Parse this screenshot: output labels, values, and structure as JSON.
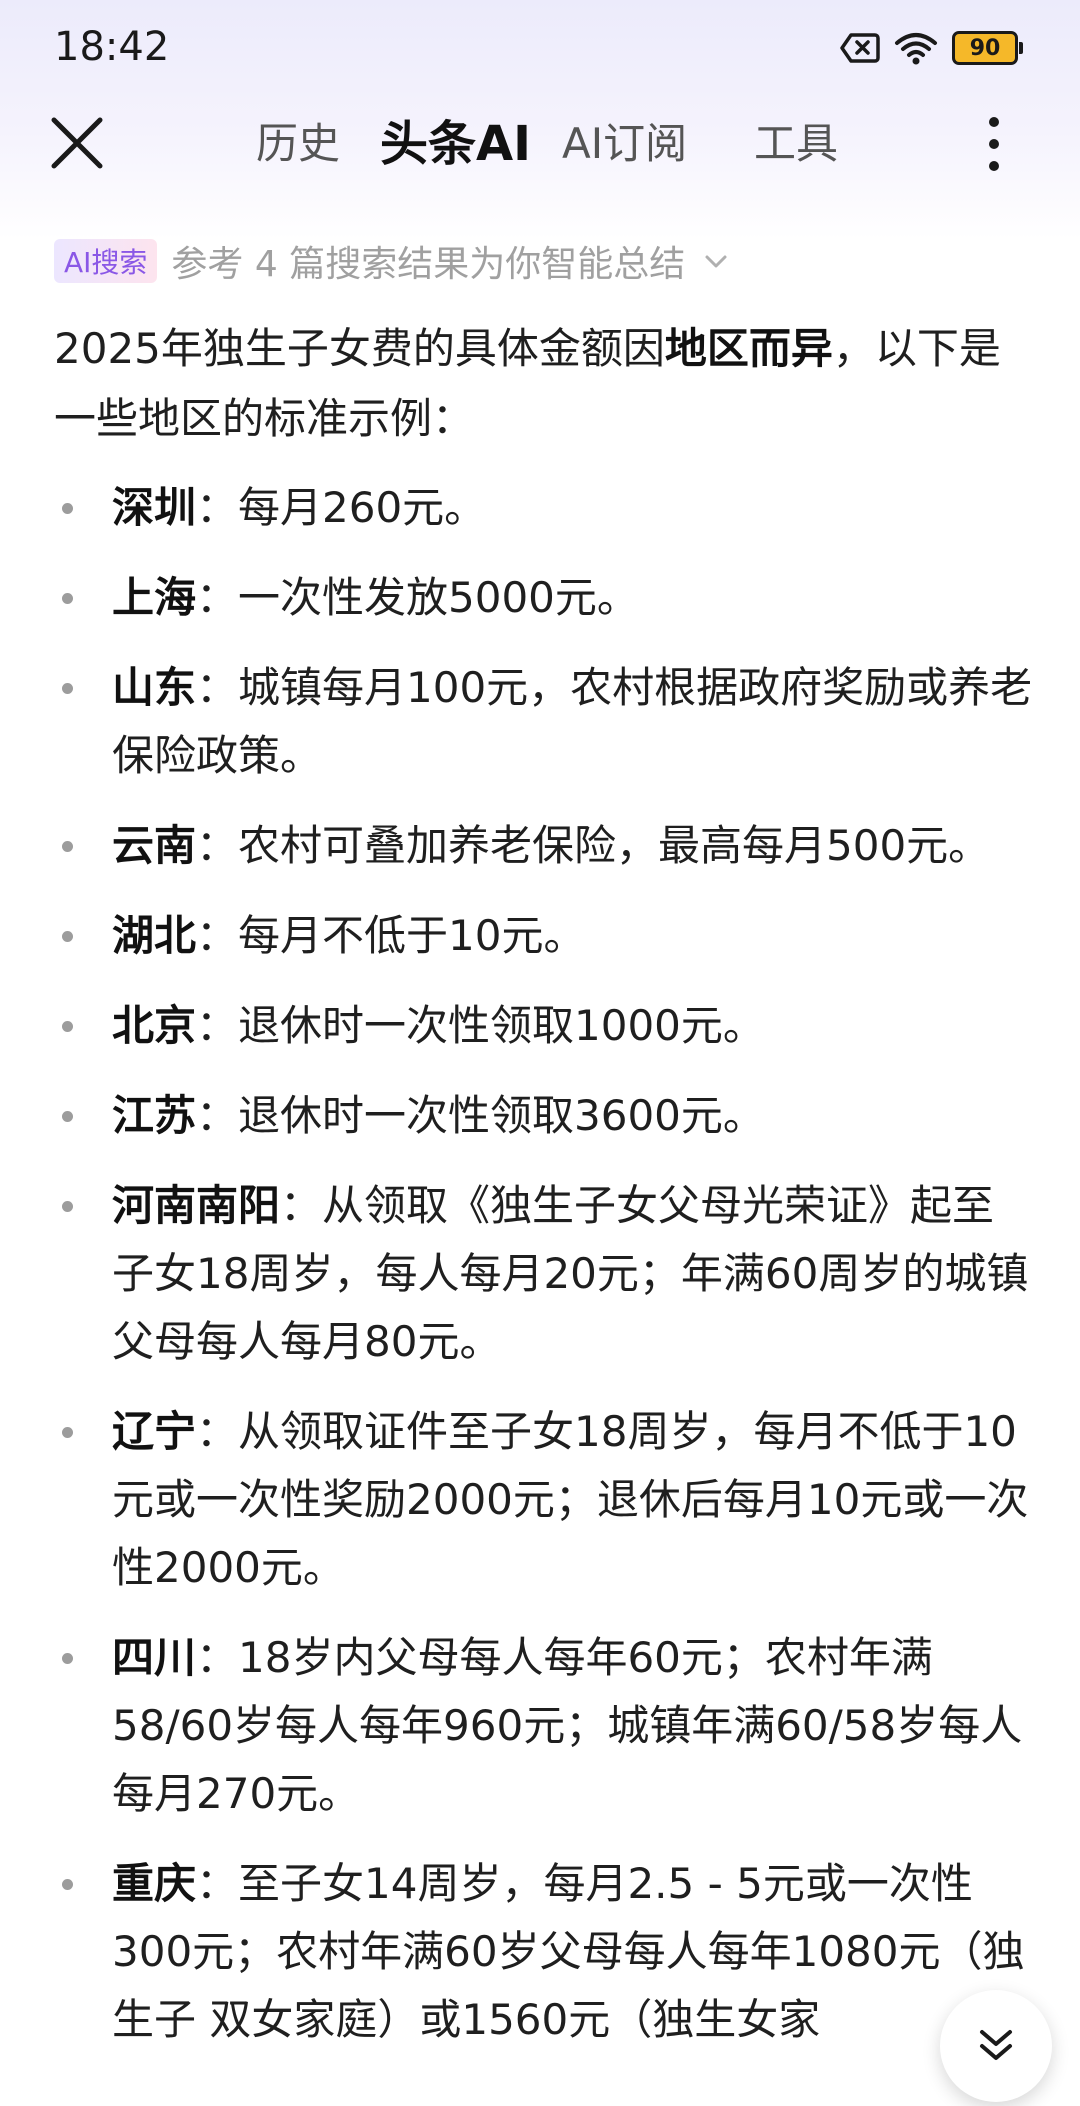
{
  "status_bar": {
    "time": "18:42",
    "battery": "90",
    "battery_color": "#f5b829"
  },
  "nav": {
    "tabs": [
      {
        "label": "历史",
        "active": false
      },
      {
        "label": "头条AI",
        "active": true
      },
      {
        "label": "AI订阅",
        "active": false
      },
      {
        "label": "工具",
        "active": false
      }
    ]
  },
  "ai_search": {
    "badge": "AI搜索",
    "summary": "参考 4 篇搜索结果为你智能总结"
  },
  "content": {
    "intro_before": "2025年独生子女费的具体金额因",
    "intro_bold": "地区而异",
    "intro_after": "，以下是一些地区的标准示例：",
    "items": [
      {
        "region": "深圳",
        "text": "：每月260元。"
      },
      {
        "region": "上海",
        "text": "：一次性发放5000元。"
      },
      {
        "region": "山东",
        "text": "：城镇每月100元，农村根据政府奖励或养老保险政策。"
      },
      {
        "region": "云南",
        "text": "：农村可叠加养老保险，最高每月500元。"
      },
      {
        "region": "湖北",
        "text": "：每月不低于10元。"
      },
      {
        "region": "北京",
        "text": "：退休时一次性领取1000元。"
      },
      {
        "region": "江苏",
        "text": "：退休时一次性领取3600元。"
      },
      {
        "region": "河南南阳",
        "text": "：从领取《独生子女父母光荣证》起至子女18周岁，每人每月20元；年满60周岁的城镇父母每人每月80元。"
      },
      {
        "region": "辽宁",
        "text": "：从领取证件至子女18周岁，每月不低于10元或一次性奖励2000元；退休后每月10元或一次性2000元。"
      },
      {
        "region": "四川",
        "text": "：18岁内父母每人每年60元；农村年满58/60岁每人每年960元；城镇年满60/58岁每人每月270元。"
      },
      {
        "region": "重庆",
        "text": "：至子女14周岁，每月2.5 - 5元或一次性300元；农村年满60岁父母每人每年1080元（独生子 双女家庭）或1560元（独生女家"
      }
    ]
  },
  "icons": {
    "close": "close-icon",
    "more": "more-vertical-icon",
    "scroll": "scroll-down-icon"
  },
  "colors": {
    "accent_purple": "#8a57e6",
    "accent_pink": "#e8507e"
  }
}
